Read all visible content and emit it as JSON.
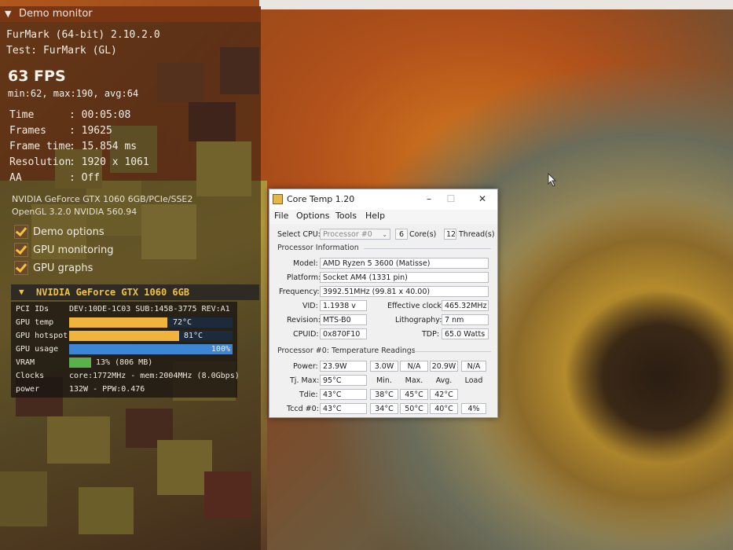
{
  "demo_monitor": {
    "title": "Demo monitor",
    "app_version": "FurMark (64-bit) 2.10.2.0",
    "test": "Test: FurMark (GL)",
    "fps": "63 FPS",
    "fps_stats": "min:62, max:190, avg:64",
    "stats": [
      {
        "key": "Time",
        "value": ": 00:05:08"
      },
      {
        "key": "Frames",
        "value": ": 19625"
      },
      {
        "key": "Frame time",
        "value": ": 15.854 ms"
      },
      {
        "key": "Resolution",
        "value": ": 1920 x 1061"
      },
      {
        "key": "AA",
        "value": ": Off"
      }
    ],
    "gpu_renderer": "NVIDIA GeForce GTX 1060 6GB/PCIe/SSE2",
    "opengl": "OpenGL 3.2.0 NVIDIA 560.94",
    "options": [
      {
        "label": "Demo options",
        "checked": true
      },
      {
        "label": "GPU monitoring",
        "checked": true
      },
      {
        "label": "GPU graphs",
        "checked": true
      }
    ],
    "gpu_section_title": "NVIDIA GeForce GTX 1060 6GB",
    "gpu_rows": {
      "pci_key": "PCI IDs",
      "pci_value": "DEV:10DE-1C03 SUB:1458-3775 REV:A1",
      "temp_key": "GPU temp",
      "temp_value": "72°C",
      "temp_fraction": 0.6,
      "temp_color": "#f0b43c",
      "hotspot_key": "GPU hotspot",
      "hotspot_value": "81°C",
      "hotspot_fraction": 0.675,
      "hotspot_color": "#f0b43c",
      "usage_key": "GPU usage",
      "usage_value": "100%",
      "usage_fraction": 1.0,
      "usage_color": "#3d86d4",
      "vram_key": "VRAM",
      "vram_value": "13% (806 MB)",
      "vram_fraction": 0.13,
      "vram_color": "#5ab04a",
      "clocks_key": "Clocks",
      "clocks_value": "core:1772MHz - mem:2004MHz (8.0Gbps)",
      "power_key": "power",
      "power_value": "132W - PPW:0.476"
    }
  },
  "coretemp": {
    "title": "Core Temp 1.20",
    "menu": [
      "File",
      "Options",
      "Tools",
      "Help"
    ],
    "select_cpu_label": "Select CPU:",
    "cpu_select": "Processor #0",
    "cores_value": "6",
    "cores_label": "Core(s)",
    "threads_value": "12",
    "threads_label": "Thread(s)",
    "proc_info_title": "Processor Information",
    "model_label": "Model:",
    "model": "AMD Ryzen 5 3600 (Matisse)",
    "platform_label": "Platform:",
    "platform": "Socket AM4 (1331 pin)",
    "frequency_label": "Frequency:",
    "frequency": "3992.51MHz (99.81 x 40.00)",
    "vid_label": "VID:",
    "vid": "1.1938 v",
    "eff_clock_label": "Effective clock:",
    "eff_clock": "465.32MHz",
    "revision_label": "Revision:",
    "revision": "MTS-B0",
    "litho_label": "Lithography:",
    "litho": "7 nm",
    "cpuid_label": "CPUID:",
    "cpuid": "0x870F10",
    "tdp_label": "TDP:",
    "tdp": "65.0 Watts",
    "temps_title": "Processor #0: Temperature Readings",
    "power_label": "Power:",
    "power_values": [
      "23.9W",
      "3.0W",
      "N/A",
      "20.9W",
      "N/A"
    ],
    "tjmax_label": "Tj. Max:",
    "tjmax": "95°C",
    "col_headers": [
      "Min.",
      "Max.",
      "Avg.",
      "Load"
    ],
    "tdie_label": "Tdie:",
    "tdie_values": [
      "43°C",
      "38°C",
      "45°C",
      "42°C"
    ],
    "tccd_label": "Tccd #0:",
    "tccd_values": [
      "43°C",
      "34°C",
      "50°C",
      "40°C",
      "4%"
    ]
  }
}
